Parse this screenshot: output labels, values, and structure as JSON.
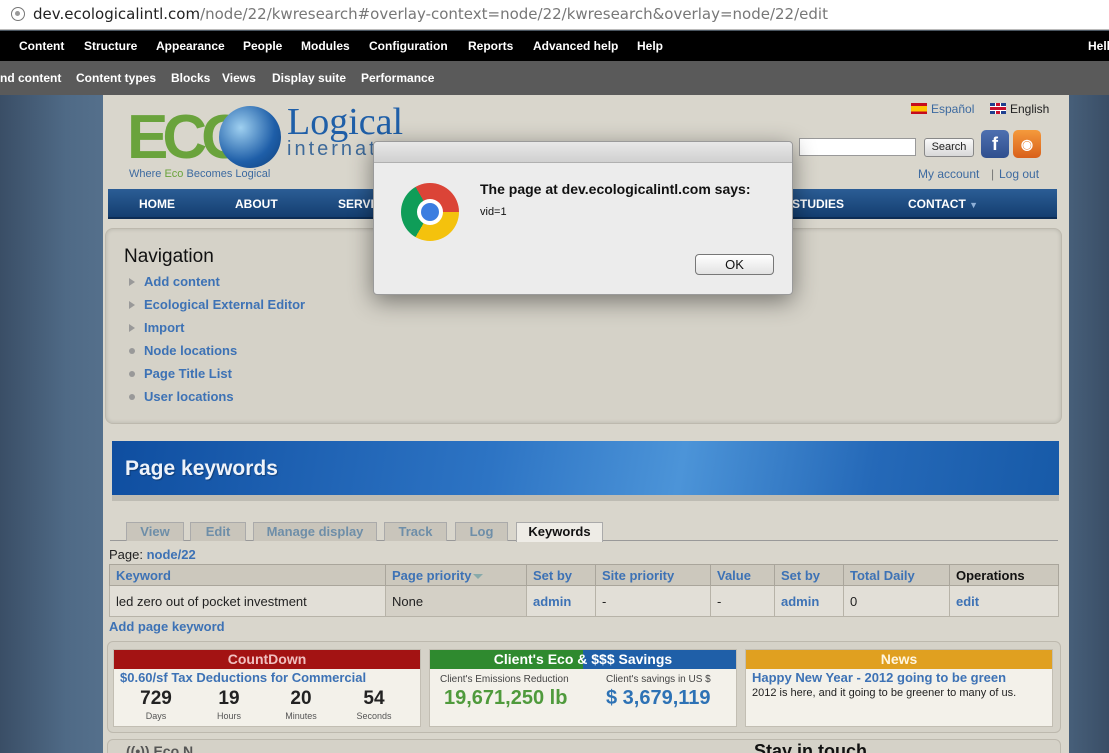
{
  "browser": {
    "url_host": "dev.ecologicalintl.com",
    "url_path": "/node/22/kwresearch#overlay-context=node/22/kwresearch&overlay=node/22/edit"
  },
  "admin_menu": [
    "Content",
    "Structure",
    "Appearance",
    "People",
    "Modules",
    "Configuration",
    "Reports",
    "Advanced help",
    "Help"
  ],
  "admin_menu_right": "Hell",
  "admin_shortcuts": [
    "nd content",
    "Content types",
    "Blocks",
    "Views",
    "Display suite",
    "Performance"
  ],
  "site": {
    "logo_eco": "ECO",
    "logo_logical": "Logical",
    "logo_intl": "internat",
    "tagline_pre": "Where ",
    "tagline_eco": "Eco",
    "tagline_post": " Becomes Logical",
    "lang_es": "Español",
    "lang_en": "English",
    "search_button": "Search",
    "facebook": "f",
    "rss": "◉",
    "my_account": "My account",
    "separator": "|",
    "log_out": "Log out"
  },
  "main_nav": [
    "HOME",
    "ABOUT",
    "SERVI",
    "STUDIES",
    "CONTACT"
  ],
  "navigation": {
    "title": "Navigation",
    "links": [
      "Add content",
      "Ecological External Editor",
      "Import",
      "Node locations",
      "Page Title List",
      "User locations"
    ]
  },
  "keywords": {
    "title": "Page keywords",
    "tabs": [
      "View",
      "Edit",
      "Manage display",
      "Track",
      "Log",
      "Keywords"
    ],
    "page_label": "Page:",
    "page_link": "node/22",
    "columns": [
      "Keyword",
      "Page priority",
      "Set by",
      "Site priority",
      "Value",
      "Set by",
      "Total Daily",
      "Operations"
    ],
    "rows": [
      [
        "led zero out of pocket investment",
        "None",
        "admin",
        "-",
        "-",
        "admin",
        "0",
        "edit"
      ]
    ],
    "add_link": "Add page keyword"
  },
  "widgets": {
    "countdown": {
      "header": "CountDown",
      "title": "$0.60/sf Tax Deductions for Commercial",
      "values": [
        "729",
        "19",
        "20",
        "54"
      ],
      "labels": [
        "Days",
        "Hours",
        "Minutes",
        "Seconds"
      ]
    },
    "savings": {
      "header": "Client's Eco & $$$ Savings",
      "label1": "Client's Emissions Reduction",
      "value1": "19,671,250 lb",
      "label2": "Client's savings in US $",
      "value2": "$ 3,679,119"
    },
    "news": {
      "header": "News",
      "title": "Happy New Year - 2012 going to be green",
      "body": "2012 is here, and it going to be greener to many of us."
    },
    "bottom_a": "((•)) Eco N",
    "bottom_b": "Stay in touch"
  },
  "dialog": {
    "title": "The page at dev.ecologicalintl.com says:",
    "message": "vid=1",
    "ok": "OK"
  },
  "colors": {
    "link": "#3d72b5",
    "nav": "#1f4f85",
    "countdown": "#a31313",
    "news": "#e0a020"
  }
}
